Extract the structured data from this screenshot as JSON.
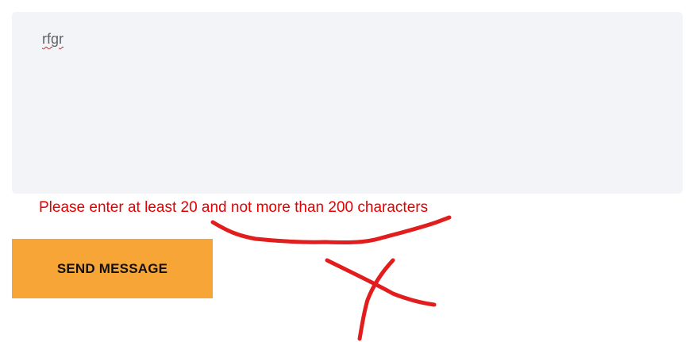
{
  "form": {
    "message_value": "rfgr",
    "error_message": "Please enter at least 20 and not more than 200 characters",
    "send_label": "SEND MESSAGE"
  },
  "colors": {
    "input_background": "#f3f4f8",
    "error": "#e60000",
    "button": "#f8a537",
    "annotation": "#e11d1d"
  },
  "annotation": {
    "marks": [
      "underline-stroke",
      "cross-mark"
    ]
  }
}
